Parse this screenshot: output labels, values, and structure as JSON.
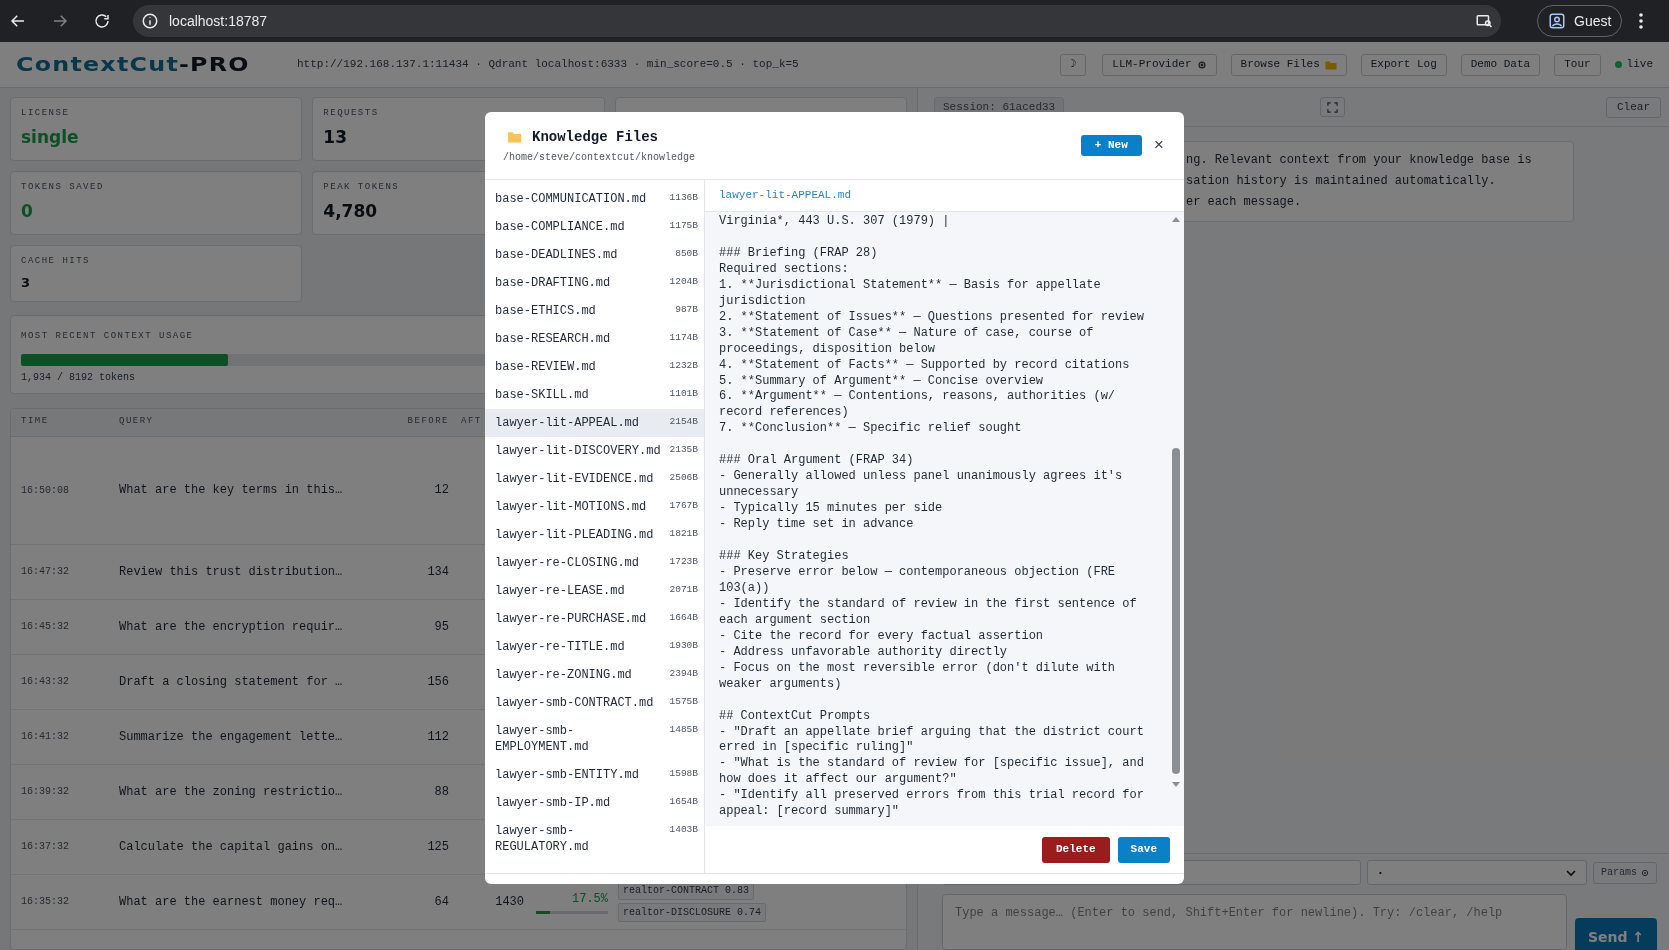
{
  "browser": {
    "url": "localhost:18787",
    "profile": "Guest"
  },
  "header": {
    "logo_main": "ContextCut",
    "logo_suffix": "-PRO",
    "info": "http://192.168.137.1:11434 · Qdrant localhost:6333 · min_score=0.5 · top_k=5",
    "buttons": [
      {
        "kind": "moon",
        "label": "☽"
      },
      {
        "kind": "gear",
        "label": "LLM-Provider"
      },
      {
        "kind": "folder",
        "label": "Browse Files"
      },
      {
        "kind": "plain",
        "label": "Export Log"
      },
      {
        "kind": "plain",
        "label": "Demo Data"
      },
      {
        "kind": "plain",
        "label": "Tour"
      }
    ],
    "status": {
      "label": "live",
      "on": true
    }
  },
  "stats": [
    {
      "label": "LICENSE",
      "value": "single",
      "accent": true
    },
    {
      "label": "REQUESTS",
      "value": "13",
      "accent": false
    },
    {
      "label": "TOKENS SAVED",
      "value": "0",
      "accent": true
    },
    {
      "label": "PEAK TOKENS",
      "value": "4,780",
      "accent": false
    },
    {
      "label": "CACHE HITS",
      "value": "3",
      "accent": false
    }
  ],
  "usage": {
    "title": "MOST RECENT CONTEXT USAGE",
    "level": 0.236,
    "reading": "1,934 / 8192 tokens"
  },
  "table": {
    "columns": [
      "TIME",
      "QUERY",
      "BEFORE",
      "AFT"
    ],
    "rows": [
      {
        "time": "16:50:08",
        "query": "What are the key terms in this…",
        "before": "12"
      },
      {
        "time": "16:47:32",
        "query": "Review this trust distribution…",
        "before": "134"
      },
      {
        "time": "16:45:32",
        "query": "What are the encryption requir…",
        "before": "95"
      },
      {
        "time": "16:43:32",
        "query": "Draft a closing statement for …",
        "before": "156"
      },
      {
        "time": "16:41:32",
        "query": "Summarize the engagement lette…",
        "before": "112"
      },
      {
        "time": "16:39:32",
        "query": "What are the zoning restrictio…",
        "before": "88"
      },
      {
        "time": "16:37:32",
        "query": "Calculate the capital gains on…",
        "before": "125"
      },
      {
        "time": "16:35:32",
        "query": "What are the earnest money req…",
        "before": "64",
        "after": "1430",
        "reduction": "17.5%",
        "level": 0.2,
        "tags": [
          {
            "name": "realtor-CONTRACT",
            "score": "0.83"
          },
          {
            "name": "realtor-DISCLOSURE",
            "score": "0.74"
          }
        ]
      }
    ]
  },
  "chat": {
    "session": "Session: 61aced33",
    "clear": "Clear",
    "message_lines": [
      "ng. Relevant context from your knowledge base is",
      "sation history is maintained automatically.",
      "er each message."
    ],
    "select_value": "•",
    "params": "Params",
    "placeholder": "Type a message… (Enter to send, Shift+Enter for newline). Try: /clear, /help",
    "send": "Send ↑"
  },
  "modal": {
    "title": "Knowledge Files",
    "path": "/home/steve/contextcut/knowledge",
    "new_button": "+ New",
    "close": "×",
    "files": [
      {
        "name": "base-COMMUNICATION.md",
        "size": "1136B",
        "selected": false
      },
      {
        "name": "base-COMPLIANCE.md",
        "size": "1175B",
        "selected": false
      },
      {
        "name": "base-DEADLINES.md",
        "size": "850B",
        "selected": false
      },
      {
        "name": "base-DRAFTING.md",
        "size": "1204B",
        "selected": false
      },
      {
        "name": "base-ETHICS.md",
        "size": "987B",
        "selected": false
      },
      {
        "name": "base-RESEARCH.md",
        "size": "1174B",
        "selected": false
      },
      {
        "name": "base-REVIEW.md",
        "size": "1232B",
        "selected": false
      },
      {
        "name": "base-SKILL.md",
        "size": "1101B",
        "selected": false
      },
      {
        "name": "lawyer-lit-APPEAL.md",
        "size": "2154B",
        "selected": true
      },
      {
        "name": "lawyer-lit-DISCOVERY.md",
        "size": "2135B",
        "selected": false
      },
      {
        "name": "lawyer-lit-EVIDENCE.md",
        "size": "2506B",
        "selected": false
      },
      {
        "name": "lawyer-lit-MOTIONS.md",
        "size": "1767B",
        "selected": false
      },
      {
        "name": "lawyer-lit-PLEADING.md",
        "size": "1821B",
        "selected": false
      },
      {
        "name": "lawyer-re-CLOSING.md",
        "size": "1723B",
        "selected": false
      },
      {
        "name": "lawyer-re-LEASE.md",
        "size": "2071B",
        "selected": false
      },
      {
        "name": "lawyer-re-PURCHASE.md",
        "size": "1664B",
        "selected": false
      },
      {
        "name": "lawyer-re-TITLE.md",
        "size": "1930B",
        "selected": false
      },
      {
        "name": "lawyer-re-ZONING.md",
        "size": "2394B",
        "selected": false
      },
      {
        "name": "lawyer-smb-CONTRACT.md",
        "size": "1575B",
        "selected": false
      },
      {
        "name": "lawyer-smb-EMPLOYMENT.md",
        "size": "1485B",
        "selected": false
      },
      {
        "name": "lawyer-smb-ENTITY.md",
        "size": "1598B",
        "selected": false
      },
      {
        "name": "lawyer-smb-IP.md",
        "size": "1654B",
        "selected": false
      },
      {
        "name": "lawyer-smb-REGULATORY.md",
        "size": "1403B",
        "selected": false
      }
    ],
    "filename": "lawyer-lit-APPEAL.md",
    "content": "Virginia*, 443 U.S. 307 (1979) |\n\n### Briefing (FRAP 28)\nRequired sections:\n1. **Jurisdictional Statement** — Basis for appellate jurisdiction\n2. **Statement of Issues** — Questions presented for review\n3. **Statement of Case** — Nature of case, course of proceedings, disposition below\n4. **Statement of Facts** — Supported by record citations\n5. **Summary of Argument** — Concise overview\n6. **Argument** — Contentions, reasons, authorities (w/ record references)\n7. **Conclusion** — Specific relief sought\n\n### Oral Argument (FRAP 34)\n- Generally allowed unless panel unanimously agrees it's unnecessary\n- Typically 15 minutes per side\n- Reply time set in advance\n\n### Key Strategies\n- Preserve error below — contemporaneous objection (FRE 103(a))\n- Identify the standard of review in the first sentence of each argument section\n- Cite the record for every factual assertion\n- Address unfavorable authority directly\n- Focus on the most reversible error (don't dilute with weaker arguments)\n\n## ContextCut Prompts\n- \"Draft an appellate brief arguing that the district court erred in [specific ruling]\"\n- \"What is the standard of review for [specific issue], and how does it affect our argument?\"\n- \"Identify all preserved errors from this trial record for appeal: [record summary]\"",
    "delete": "Delete",
    "save": "Save"
  }
}
